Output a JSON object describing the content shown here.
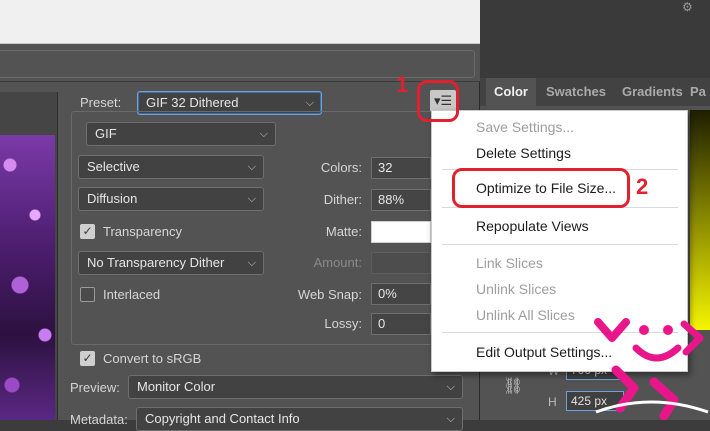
{
  "dialog": {
    "preset_label": "Preset:",
    "preset_value": "GIF 32 Dithered",
    "format_value": "GIF",
    "reduction_value": "Selective",
    "dither_algo_value": "Diffusion",
    "transparency_label": "Transparency",
    "transparency_checked": true,
    "transparency_dither_value": "No Transparency Dither",
    "interlaced_label": "Interlaced",
    "interlaced_checked": false,
    "colors_label": "Colors:",
    "colors_value": "32",
    "dither_label": "Dither:",
    "dither_value": "88%",
    "matte_label": "Matte:",
    "amount_label": "Amount:",
    "web_snap_label": "Web Snap:",
    "web_snap_value": "0%",
    "lossy_label": "Lossy:",
    "lossy_value": "0",
    "convert_srgb_label": "Convert to sRGB",
    "convert_srgb_checked": true,
    "preview_label": "Preview:",
    "preview_value": "Monitor Color",
    "metadata_label": "Metadata:",
    "metadata_value": "Copyright and Contact Info"
  },
  "menu": {
    "items": [
      {
        "label": "Save Settings...",
        "enabled": false
      },
      {
        "label": "Delete Settings",
        "enabled": true
      },
      {
        "label": "Optimize to File Size...",
        "enabled": true
      },
      {
        "label": "Repopulate Views",
        "enabled": true
      },
      {
        "label": "Link Slices",
        "enabled": false
      },
      {
        "label": "Unlink Slices",
        "enabled": false
      },
      {
        "label": "Unlink All Slices",
        "enabled": false
      },
      {
        "label": "Edit Output Settings...",
        "enabled": true
      }
    ]
  },
  "right_panel": {
    "tabs": [
      "Color",
      "Swatches",
      "Gradients",
      "Pa"
    ],
    "active_tab": "Color",
    "w_label": "W",
    "w_value": "700 px",
    "h_label": "H",
    "h_value": "425 px"
  },
  "annotations": {
    "marker_1": "1",
    "marker_2": "2",
    "color": "#e2202e"
  },
  "colors": {
    "dialog_bg": "#535353",
    "accent_focus": "#6fa1e0"
  },
  "icons": [
    "menu-lines-icon",
    "chevron-down-icon",
    "checkmark-icon",
    "link-chain-icon",
    "gear-icon"
  ]
}
